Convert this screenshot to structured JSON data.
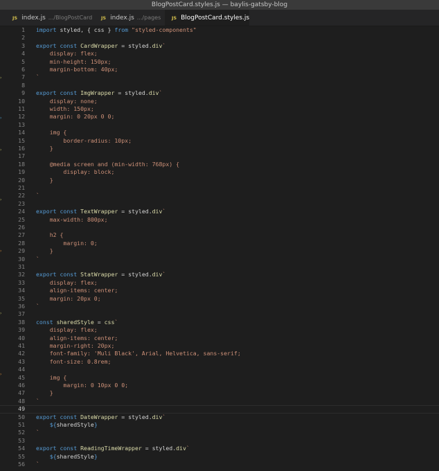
{
  "window": {
    "title": "BlogPostCard.styles.js — baylis-gatsby-blog"
  },
  "tabs": [
    {
      "icon": "JS",
      "name": "index.js",
      "path": ".../BlogPostCard",
      "active": false
    },
    {
      "icon": "JS",
      "name": "index.js",
      "path": ".../pages",
      "active": false
    },
    {
      "icon": "JS",
      "name": "BlogPostCard.styles.js",
      "path": "",
      "active": true
    }
  ],
  "editor": {
    "current_line": 49,
    "lines": [
      [
        [
          "k",
          "import "
        ],
        [
          "w",
          "styled, { css } "
        ],
        [
          "k",
          "from "
        ],
        [
          "s",
          "\"styled-components\""
        ]
      ],
      [],
      [
        [
          "k",
          "export const "
        ],
        [
          "f",
          "CardWrapper"
        ],
        [
          "w",
          " = styled."
        ],
        [
          "f",
          "div"
        ],
        [
          "s",
          "`"
        ]
      ],
      [
        [
          "s",
          "    display: flex;"
        ]
      ],
      [
        [
          "s",
          "    min-height: 150px;"
        ]
      ],
      [
        [
          "s",
          "    margin-bottom: 40px;"
        ]
      ],
      [
        [
          "s",
          "`"
        ]
      ],
      [],
      [
        [
          "k",
          "export const "
        ],
        [
          "f",
          "ImgWrapper"
        ],
        [
          "w",
          " = styled."
        ],
        [
          "f",
          "div"
        ],
        [
          "s",
          "`"
        ]
      ],
      [
        [
          "s",
          "    display: none;"
        ]
      ],
      [
        [
          "s",
          "    width: 150px;"
        ]
      ],
      [
        [
          "s",
          "    margin: 0 20px 0 0;"
        ]
      ],
      [],
      [
        [
          "s",
          "    img {"
        ]
      ],
      [
        [
          "s",
          "        border-radius: 10px;"
        ]
      ],
      [
        [
          "s",
          "    }"
        ]
      ],
      [],
      [
        [
          "s",
          "    @media screen and (min-width: 768px) {"
        ]
      ],
      [
        [
          "s",
          "        display: block;"
        ]
      ],
      [
        [
          "s",
          "    }"
        ]
      ],
      [],
      [
        [
          "s",
          "`"
        ]
      ],
      [],
      [
        [
          "k",
          "export const "
        ],
        [
          "f",
          "TextWrapper"
        ],
        [
          "w",
          " = styled."
        ],
        [
          "f",
          "div"
        ],
        [
          "s",
          "`"
        ]
      ],
      [
        [
          "s",
          "    max-width: 800px;"
        ]
      ],
      [],
      [
        [
          "s",
          "    h2 {"
        ]
      ],
      [
        [
          "s",
          "        margin: 0;"
        ]
      ],
      [
        [
          "s",
          "    }"
        ]
      ],
      [
        [
          "s",
          "`"
        ]
      ],
      [],
      [
        [
          "k",
          "export const "
        ],
        [
          "f",
          "StatWrapper"
        ],
        [
          "w",
          " = styled."
        ],
        [
          "f",
          "div"
        ],
        [
          "s",
          "`"
        ]
      ],
      [
        [
          "s",
          "    display: flex;"
        ]
      ],
      [
        [
          "s",
          "    align-items: center;"
        ]
      ],
      [
        [
          "s",
          "    margin: 20px 0;"
        ]
      ],
      [
        [
          "s",
          "`"
        ]
      ],
      [],
      [
        [
          "k",
          "const "
        ],
        [
          "f",
          "sharedStyle"
        ],
        [
          "w",
          " = "
        ],
        [
          "f",
          "css"
        ],
        [
          "s",
          "`"
        ]
      ],
      [
        [
          "s",
          "    display: flex;"
        ]
      ],
      [
        [
          "s",
          "    align-items: center;"
        ]
      ],
      [
        [
          "s",
          "    margin-right: 20px;"
        ]
      ],
      [
        [
          "s",
          "    font-family: 'Muli Black', Arial, Helvetica, sans-serif;"
        ]
      ],
      [
        [
          "s",
          "    font-size: 0.8rem;"
        ]
      ],
      [],
      [
        [
          "s",
          "    img {"
        ]
      ],
      [
        [
          "s",
          "        margin: 0 10px 0 0;"
        ]
      ],
      [
        [
          "s",
          "    }"
        ]
      ],
      [
        [
          "s",
          "`"
        ]
      ],
      [],
      [
        [
          "k",
          "export const "
        ],
        [
          "f",
          "DateWrapper"
        ],
        [
          "w",
          " = styled."
        ],
        [
          "f",
          "div"
        ],
        [
          "s",
          "`"
        ]
      ],
      [
        [
          "s",
          "    "
        ],
        [
          "k",
          "${"
        ],
        [
          "w",
          "sharedStyle"
        ],
        [
          "k",
          "}"
        ]
      ],
      [
        [
          "s",
          "`"
        ]
      ],
      [],
      [
        [
          "k",
          "export const "
        ],
        [
          "f",
          "ReadingTimeWrapper"
        ],
        [
          "w",
          " = styled."
        ],
        [
          "f",
          "div"
        ],
        [
          "s",
          "`"
        ]
      ],
      [
        [
          "s",
          "    "
        ],
        [
          "k",
          "${"
        ],
        [
          "w",
          "sharedStyle"
        ],
        [
          "k",
          "}"
        ]
      ],
      [
        [
          "s",
          "`"
        ]
      ]
    ]
  },
  "colors": {
    "keyword": "#569cd6",
    "function": "#dcdcaa",
    "string": "#ce9178",
    "text": "#d4d4d4",
    "editor_bg": "#1e1e1e",
    "line_number": "#858585"
  }
}
